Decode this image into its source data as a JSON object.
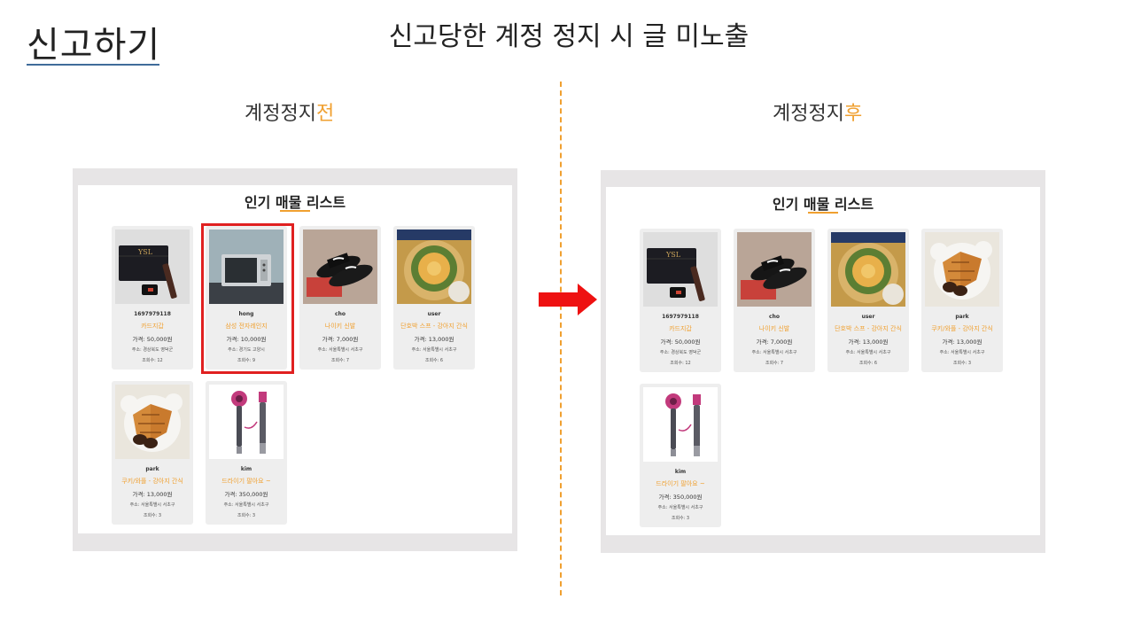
{
  "header": {
    "title": "신고하기",
    "subtitle": "신고당한 계정 정지 시 글 미노출"
  },
  "before": {
    "caption_main": "계정정지",
    "caption_accent": "전",
    "list_title": "인기 매물 리스트",
    "cards": [
      {
        "user": "1697979118",
        "title": "카드지갑",
        "price": "가격: 50,000원",
        "addr": "주소: 경상북도 영덕군",
        "views": "조회수: 12",
        "icon": "card-wallet-photo"
      },
      {
        "user": "hong",
        "title": "삼성 전자레인지",
        "price": "가격: 10,000원",
        "addr": "주소: 경기도 고양시",
        "views": "조회수: 9",
        "icon": "microwave-photo"
      },
      {
        "user": "cho",
        "title": "나이키 신발",
        "price": "가격: 7,000원",
        "addr": "주소: 서울특별시 서초구",
        "views": "조회수: 7",
        "icon": "slippers-photo"
      },
      {
        "user": "user",
        "title": "단호박 스프 - 강아지 간식",
        "price": "가격: 13,000원",
        "addr": "주소: 서울특별시 서초구",
        "views": "조회수: 6",
        "icon": "pumpkin-soup-photo"
      },
      {
        "user": "park",
        "title": "쿠키/와플 - 강아지 간식",
        "price": "가격: 13,000원",
        "addr": "주소: 서울특별시 서초구",
        "views": "조회수: 3",
        "icon": "waffle-photo"
      },
      {
        "user": "kim",
        "title": "드라이기 팔아요 ~",
        "price": "가격: 350,000원",
        "addr": "주소: 서울특별시 서초구",
        "views": "조회수: 3",
        "icon": "hair-dryer-photo"
      }
    ]
  },
  "after": {
    "caption_main": "계정정지",
    "caption_accent": "후",
    "list_title": "인기 매물 리스트",
    "cards": [
      {
        "user": "1697979118",
        "title": "카드지갑",
        "price": "가격: 50,000원",
        "addr": "주소: 경상북도 영덕군",
        "views": "조회수: 12",
        "icon": "card-wallet-photo"
      },
      {
        "user": "cho",
        "title": "나이키 신발",
        "price": "가격: 7,000원",
        "addr": "주소: 서울특별시 서초구",
        "views": "조회수: 7",
        "icon": "slippers-photo"
      },
      {
        "user": "user",
        "title": "단호박 스프 - 강아지 간식",
        "price": "가격: 13,000원",
        "addr": "주소: 서울특별시 서초구",
        "views": "조회수: 6",
        "icon": "pumpkin-soup-photo"
      },
      {
        "user": "park",
        "title": "쿠키/와플 - 강아지 간식",
        "price": "가격: 13,000원",
        "addr": "주소: 서울특별시 서초구",
        "views": "조회수: 3",
        "icon": "waffle-photo"
      },
      {
        "user": "kim",
        "title": "드라이기 팔아요 ~",
        "price": "가격: 350,000원",
        "addr": "주소: 서울특별시 서초구",
        "views": "조회수: 3",
        "icon": "hair-dryer-photo"
      }
    ]
  },
  "colors": {
    "accent": "#f0a030",
    "highlight": "#e02020",
    "arrow": "#ee1111"
  }
}
